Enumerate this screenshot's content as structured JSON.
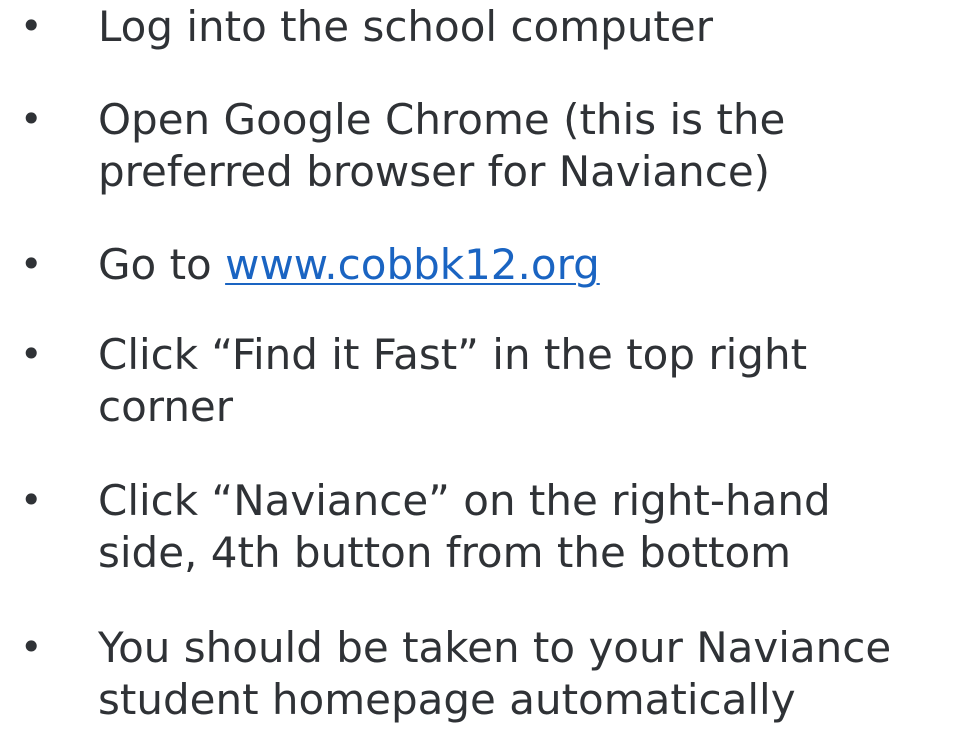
{
  "bullets": [
    {
      "lines": [
        "Log into the school computer"
      ]
    },
    {
      "lines": [
        "Open Google Chrome (this is the",
        "preferred browser for Naviance)"
      ]
    },
    {
      "prefix": "Go to ",
      "link": "www.cobbk12.org"
    },
    {
      "lines": [
        "Click “Find it Fast” in the top right",
        "corner"
      ]
    },
    {
      "lines": [
        "Click “Naviance” on the right-hand",
        "side, 4th button from the bottom"
      ]
    },
    {
      "lines": [
        "You should be taken to your Naviance",
        "student homepage automatically"
      ]
    }
  ],
  "bullet_symbol": "•",
  "colors": {
    "text": "#2f3236",
    "link": "#1a64c2",
    "background": "#ffffff"
  }
}
